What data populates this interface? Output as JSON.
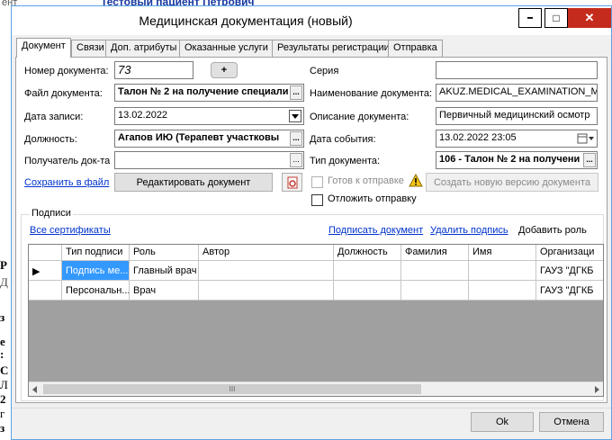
{
  "background": {
    "top_text": "ент",
    "top_link": "Тестовый пациент Петрович",
    "left_glyphs": [
      "Р",
      "Д",
      "з",
      "е",
      ":",
      "С",
      "Л",
      "2",
      "г",
      "з"
    ]
  },
  "window": {
    "title": "Медицинская документация (новый)",
    "minimize_icon": "━",
    "maximize_icon": "□",
    "close_icon": "✕"
  },
  "tabs": [
    {
      "label": "Документ",
      "active": true
    },
    {
      "label": "Связи",
      "active": false
    },
    {
      "label": "Доп. атрибуты",
      "active": false
    },
    {
      "label": "Оказанные услуги",
      "active": false
    },
    {
      "label": "Результаты регистрации",
      "active": false
    },
    {
      "label": "Отправка",
      "active": false
    }
  ],
  "form": {
    "doc_number_label": "Номер документа:",
    "doc_number_value": "73",
    "plus_button": "+",
    "file_label": "Файл документа:",
    "file_value": "Талон № 2 на получение специали",
    "record_date_label": "Дата записи:",
    "record_date_value": "13.02.2022",
    "position_label": "Должность:",
    "position_value": "Агапов ИЮ (Терапевт участковы",
    "recipient_label": "Получатель док-та",
    "recipient_value": "",
    "ellipsis": "...",
    "series_label": "Серия",
    "series_value": "",
    "doc_name_label": "Наименование документа:",
    "doc_name_value": "AKUZ.MEDICAL_EXAMINATION_MAII",
    "doc_desc_label": "Описание документа:",
    "doc_desc_value": "Первичный медицинский осмотр",
    "event_date_label": "Дата события:",
    "event_date_value": "13.02.2022 23:05",
    "doc_type_label": "Тип документа:",
    "doc_type_value": "106 - Талон № 2 на получени",
    "save_to_file": "Сохранить в файл",
    "edit_document": "Редактировать документ",
    "ready_to_send": "Готов к отправке",
    "new_version": "Создать новую версию документа",
    "postpone_send": "Отложить отправку"
  },
  "signatures": {
    "group_label": "Подписи",
    "all_certs": "Все сертификаты",
    "sign_doc": "Подписать документ",
    "delete_sign": "Удалить подпись",
    "add_role": "Добавить роль",
    "columns": [
      "Тип подписи",
      "Роль",
      "Автор",
      "Должность",
      "Фамилия",
      "Имя",
      "Организаци"
    ],
    "rows": [
      {
        "marker": "▶",
        "cells": [
          "Подпись ме...",
          "Главный врач",
          "",
          "",
          "",
          "",
          "ГАУЗ \"ДГКБ"
        ]
      },
      {
        "marker": "",
        "cells": [
          "Персональн...",
          "Врач",
          "",
          "",
          "",
          "",
          "ГАУЗ \"ДГКБ"
        ]
      }
    ],
    "scroll_thumb": "III"
  },
  "footer": {
    "ok": "Ok",
    "cancel": "Отмена"
  },
  "colors": {
    "selected_cell": "#3399ff",
    "close_button": "#c42b1c",
    "link": "#0033cc"
  }
}
